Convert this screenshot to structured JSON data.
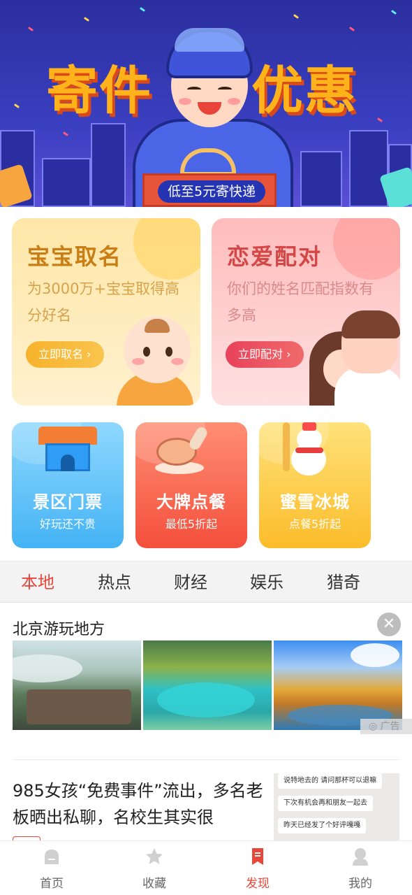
{
  "banner": {
    "title_left": "寄件",
    "title_right": "优惠",
    "pill": "低至5元寄快递"
  },
  "cards": {
    "baby": {
      "title": "宝宝取名",
      "desc": "为3000万+宝宝取得高分好名",
      "button": "立即取名 ›"
    },
    "love": {
      "title": "恋爱配对",
      "desc": "你们的姓名匹配指数有多高",
      "button": "立即配对 ›"
    }
  },
  "mini_cards": [
    {
      "title": "景区门票",
      "desc": "好玩还不贵"
    },
    {
      "title": "大牌点餐",
      "desc": "最低5折起"
    },
    {
      "title": "蜜雪冰城",
      "desc": "点餐5折起"
    }
  ],
  "tabs": [
    "本地",
    "热点",
    "财经",
    "娱乐",
    "猎奇"
  ],
  "active_tab": "本地",
  "feed": {
    "headline": "北京游玩地方",
    "ad_label": "广告",
    "article": "985女孩“免费事件”流出，多名老板晒出私聊，名校生其实很",
    "thumb_messages": [
      "说特地去的 请问那杯可以退嘛",
      "下次有机会再和朋友一起去",
      "昨天已经发了个好评嘎嘎"
    ]
  },
  "bottom_nav": [
    {
      "label": "首页",
      "icon": "home-icon"
    },
    {
      "label": "收藏",
      "icon": "star-icon"
    },
    {
      "label": "发现",
      "icon": "bookmark-icon"
    },
    {
      "label": "我的",
      "icon": "user-icon"
    }
  ],
  "colors": {
    "accent": "#e8473a"
  }
}
